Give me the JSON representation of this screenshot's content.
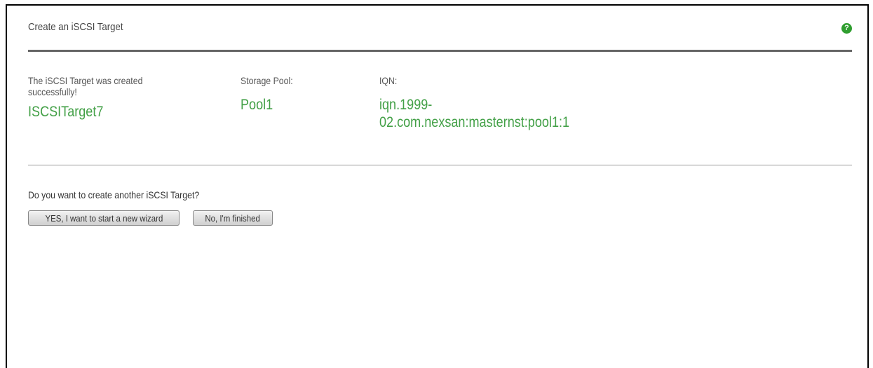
{
  "panel": {
    "title": "Create an iSCSI Target",
    "help_icon": "?"
  },
  "result": {
    "message": "The iSCSI Target was created successfully!",
    "target_name": "ISCSITarget7",
    "storage_pool_label": "Storage Pool:",
    "storage_pool_value": "Pool1",
    "iqn_label": "IQN:",
    "iqn_value_line1": "iqn.1999-",
    "iqn_value_line2": "02.com.nexsan:masternst:pool1:1"
  },
  "prompt": {
    "question": "Do you want to create another iSCSI Target?",
    "yes_label": "YES, I want to start a new wizard",
    "no_label": "No, I'm finished"
  },
  "colors": {
    "accent_green": "#43a047",
    "help_icon_green": "#2f9e2f"
  }
}
